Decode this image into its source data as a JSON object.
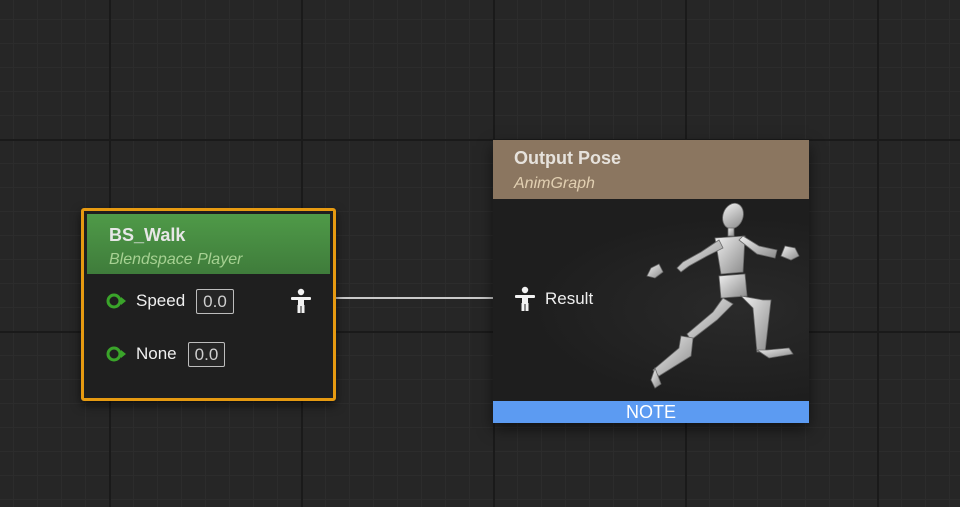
{
  "colors": {
    "grid_background": "#262626",
    "blendspace_header": "#3f7c3b",
    "selection_border": "#e69a11",
    "output_header": "#8b7660",
    "note_bar": "#5c9bf2",
    "exec_pin": "#3aa42a"
  },
  "blendspace_node": {
    "title": "BS_Walk",
    "subtitle": "Blendspace Player",
    "inputs": [
      {
        "label": "Speed",
        "value": "0.0",
        "icon": "circle-arrow-pin-icon"
      },
      {
        "label": "None",
        "value": "0.0",
        "icon": "circle-arrow-pin-icon"
      }
    ],
    "output_icon": "pose-pin-icon"
  },
  "output_node": {
    "title": "Output Pose",
    "subtitle": "AnimGraph",
    "input_label": "Result",
    "input_icon": "pose-pin-icon",
    "preview_icon": "running-mannequin-icon",
    "note_label": "NOTE"
  }
}
